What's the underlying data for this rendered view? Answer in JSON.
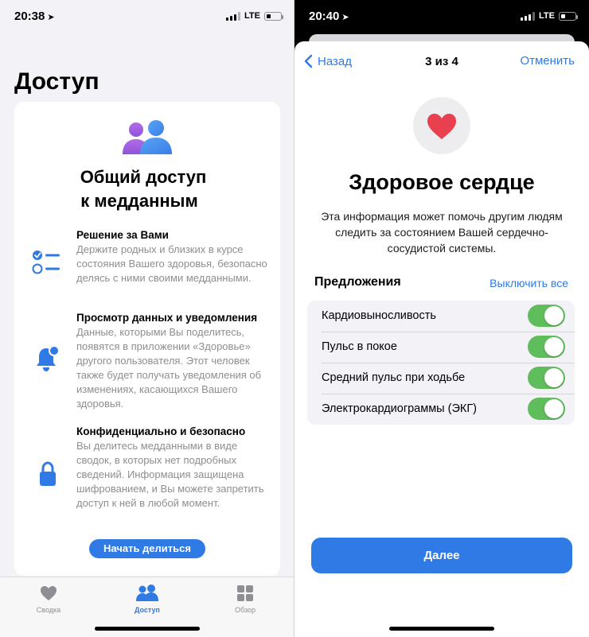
{
  "left": {
    "status": {
      "time": "20:38",
      "network": "LTE"
    },
    "title": "Доступ",
    "card": {
      "title_line1": "Общий доступ",
      "title_line2": "к медданным",
      "features": [
        {
          "title": "Решение за Вами",
          "text": "Держите родных и близких в курсе состояния Вашего здоровья, безопасно делясь с ними своими медданными.",
          "icon": "checklist-icon"
        },
        {
          "title": "Просмотр данных и уведомления",
          "text": "Данные, которыми Вы поделитесь, появятся в приложении «Здоровье» другого пользователя. Этот человек также будет получать уведомления об изменениях, касающихся Вашего здоровья.",
          "icon": "bell-badge-icon"
        },
        {
          "title": "Конфиденциально и безопасно",
          "text": "Вы делитесь медданными в виде сводок, в которых нет подробных сведений. Информация защищена шифрованием, и Вы можете запретить доступ к ней в любой момент.",
          "icon": "lock-icon"
        }
      ],
      "button": "Начать делиться"
    },
    "tabs": [
      {
        "label": "Сводка",
        "icon": "heart-icon",
        "active": false
      },
      {
        "label": "Доступ",
        "icon": "people-icon",
        "active": true
      },
      {
        "label": "Обзор",
        "icon": "grid-icon",
        "active": false
      }
    ]
  },
  "right": {
    "status": {
      "time": "20:40",
      "network": "LTE"
    },
    "nav": {
      "back": "Назад",
      "step": "3 из 4",
      "cancel": "Отменить"
    },
    "title": "Здоровое сердце",
    "description": "Эта информация может помочь другим людям следить за состоянием Вашей сердечно-сосудистой системы.",
    "suggestions_label": "Предложения",
    "disable_all": "Выключить все",
    "items": [
      {
        "label": "Кардиовыносливость",
        "on": true
      },
      {
        "label": "Пульс в покое",
        "on": true
      },
      {
        "label": "Средний пульс при ходьбе",
        "on": true
      },
      {
        "label": "Электрокардиограммы (ЭКГ)",
        "on": true
      }
    ],
    "next": "Далее"
  },
  "colors": {
    "accent": "#2f7ae5",
    "toggle_on": "#5fbe5b",
    "heart": "#e8404f",
    "people_purple": "#a45ee0"
  }
}
